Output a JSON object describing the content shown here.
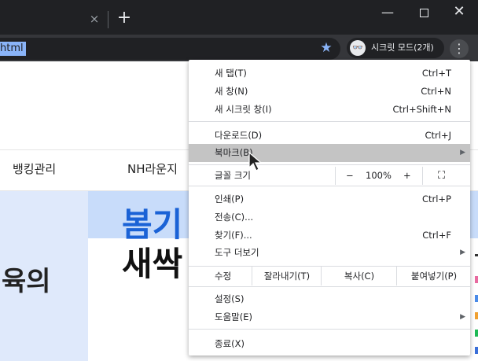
{
  "window": {
    "tab_close": "×",
    "new_tab": "+",
    "min": "—",
    "close": "✕"
  },
  "toolbar": {
    "url_visible": "html",
    "star_icon": "★",
    "incognito_label": "시크릿 모드(2개)",
    "incognito_icon": "👓",
    "menu_icon": "⋮"
  },
  "page": {
    "nav": [
      "뱅킹관리",
      "NH라운지"
    ],
    "hero_line1": "봄기",
    "hero_line2": "새싹",
    "hero_fragment": "육의"
  },
  "menu": {
    "new_tab": {
      "label": "새 탭(T)",
      "shortcut": "Ctrl+T"
    },
    "new_window": {
      "label": "새 창(N)",
      "shortcut": "Ctrl+N"
    },
    "new_incognito": {
      "label": "새 시크릿 창(I)",
      "shortcut": "Ctrl+Shift+N"
    },
    "downloads": {
      "label": "다운로드(D)",
      "shortcut": "Ctrl+J"
    },
    "bookmarks": {
      "label": "북마크(B)",
      "arrow": "▶"
    },
    "zoom": {
      "label": "글꼴 크기",
      "minus": "−",
      "value": "100%",
      "plus": "+",
      "fullscreen": "⛶"
    },
    "print": {
      "label": "인쇄(P)",
      "shortcut": "Ctrl+P"
    },
    "cast": {
      "label": "전송(C)..."
    },
    "find": {
      "label": "찾기(F)...",
      "shortcut": "Ctrl+F"
    },
    "more_tools": {
      "label": "도구 더보기",
      "arrow": "▶"
    },
    "edit": {
      "label": "수정",
      "cut": "잘라내기(T)",
      "copy": "복사(C)",
      "paste": "붙여넣기(P)"
    },
    "settings": {
      "label": "설정(S)"
    },
    "help": {
      "label": "도움말(E)",
      "arrow": "▶"
    },
    "exit": {
      "label": "종료(X)"
    }
  },
  "colors": {
    "titlebar": "#202124",
    "toolbar": "#35363a",
    "accent": "#8ab4f8",
    "hero_blue": "#1a62d6",
    "menu_highlight": "#c4c4c4"
  }
}
